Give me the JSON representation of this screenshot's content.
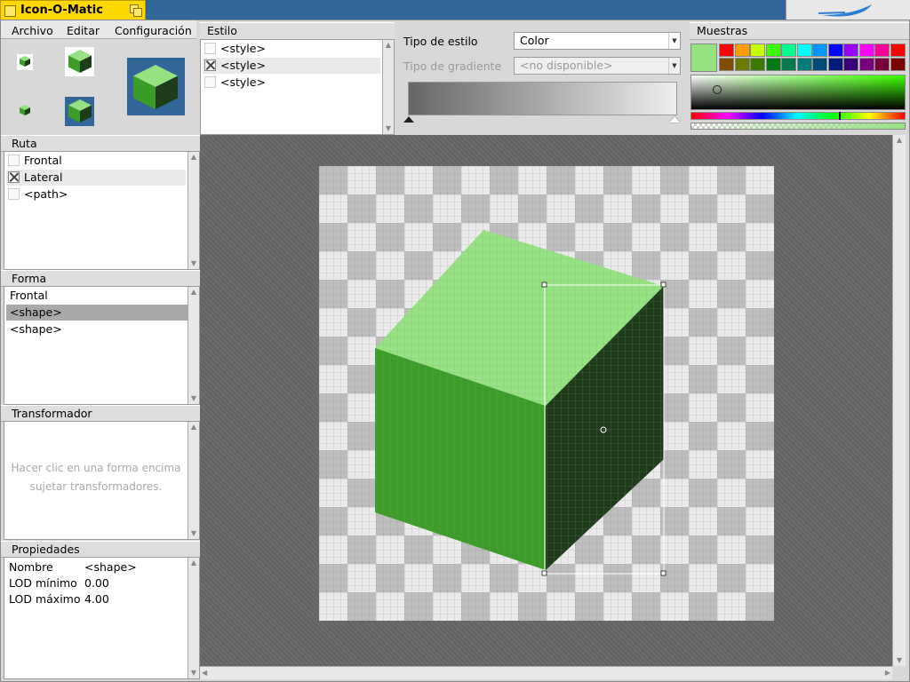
{
  "window": {
    "title": "Icon-O-Matic"
  },
  "menu": {
    "items": [
      "Archivo",
      "Editar",
      "Configuración"
    ]
  },
  "style_panel": {
    "header": "Estilo",
    "items": [
      {
        "label": "<style>",
        "checked": false
      },
      {
        "label": "<style>",
        "checked": true
      },
      {
        "label": "<style>",
        "checked": false
      }
    ]
  },
  "style_props": {
    "style_type_label": "Tipo de estilo",
    "style_type_value": "Color",
    "gradient_type_label": "Tipo de gradiente",
    "gradient_type_value": "<no disponible>"
  },
  "swatches": {
    "header": "Muestras",
    "current_color": "#96e282",
    "row1": [
      "#ff0000",
      "#ff9c00",
      "#c8ff00",
      "#3cff00",
      "#00ff8c",
      "#00ffff",
      "#0096ff",
      "#0000ff",
      "#9600ff",
      "#ff00ff",
      "#ff0096",
      "#ff0000"
    ],
    "row2": [
      "#804c00",
      "#6b7a00",
      "#3a7a00",
      "#007a14",
      "#007a4a",
      "#007a7a",
      "#004a7a",
      "#001a7a",
      "#3a007a",
      "#7a007a",
      "#7a003a",
      "#7a0000"
    ]
  },
  "path_panel": {
    "header": "Ruta",
    "items": [
      {
        "label": "Frontal",
        "checked": false
      },
      {
        "label": "Lateral",
        "checked": true
      },
      {
        "label": "<path>",
        "checked": false
      }
    ]
  },
  "shape_panel": {
    "header": "Forma",
    "items": [
      "Frontal",
      "<shape>",
      "<shape>"
    ]
  },
  "transformer_panel": {
    "header": "Transformador",
    "hint": "Hacer clic en una forma encima sujetar transformadores."
  },
  "properties_panel": {
    "header": "Propiedades",
    "rows": [
      {
        "label": "Nombre",
        "value": "<shape>"
      },
      {
        "label": "LOD mínimo",
        "value": "0.00"
      },
      {
        "label": "LOD máximo",
        "value": "4.00"
      }
    ]
  },
  "colors": {
    "cube_top": "#96e282",
    "cube_front": "#3c9c28",
    "cube_side": "#1e3c1a",
    "accent": "#ffd800"
  }
}
